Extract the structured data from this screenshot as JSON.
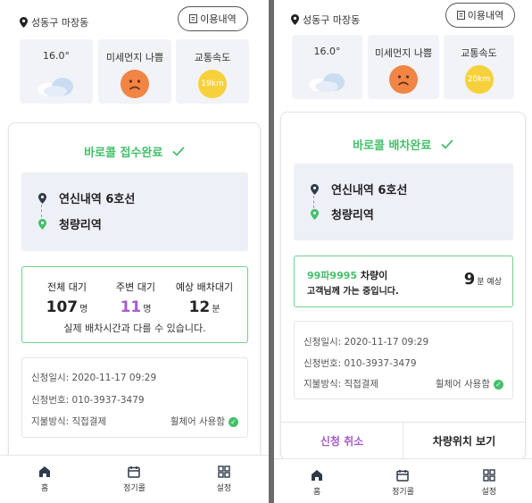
{
  "location": "성동구 마장동",
  "history_button": "이용내역",
  "weather": [
    {
      "label": "16.0°",
      "icon": "cloud-icon"
    },
    {
      "label": "미세먼지 나쁨",
      "icon": "sad-face-icon"
    },
    {
      "label": "교통속도",
      "icon": "speed-icon",
      "value": "19km"
    }
  ],
  "weather_right_speed": "20km",
  "left_screen": {
    "status": "바로콜 접수완료",
    "route": {
      "origin": "연신내역 6호선",
      "destination": "청량리역"
    },
    "waiting": [
      {
        "header": "전체 대기",
        "value": "107",
        "unit": "명"
      },
      {
        "header": "주변 대기",
        "value": "11",
        "unit": "명"
      },
      {
        "header": "예상 배차대기",
        "value": "12",
        "unit": "분"
      }
    ],
    "waiting_note": "실제 배차시간과 다를 수 있습니다.",
    "info": {
      "date": "신청일시: 2020-11-17 09:29",
      "phone": "신청번호: 010-3937-3479",
      "payment": "지불방식: 직접결제",
      "wheelchair": "휠체어 사용함"
    }
  },
  "right_screen": {
    "status": "바로콜 배차완료",
    "route": {
      "origin": "연신내역 6호선",
      "destination": "청량리역"
    },
    "dispatch": {
      "plate": "99파9995",
      "line1_suffix": " 차량이",
      "line2": "고객님께 가는 중입니다.",
      "eta_value": "9",
      "eta_unit": "분 예상"
    },
    "info": {
      "date": "신청일시: 2020-11-17 09:29",
      "phone": "신청번호: 010-3937-3479",
      "payment": "지불방식: 직접결제",
      "wheelchair": "휠체어 사용함"
    },
    "actions": {
      "cancel": "신청 취소",
      "view_location": "차량위치 보기"
    }
  },
  "tabs": [
    {
      "label": "홈",
      "icon": "home-icon"
    },
    {
      "label": "정기콜",
      "icon": "calendar-icon"
    },
    {
      "label": "설정",
      "icon": "grid-icon"
    }
  ],
  "colors": {
    "accent_green": "#43c06a",
    "accent_purple": "#a55cc9",
    "box_green": "#6ed28b"
  }
}
